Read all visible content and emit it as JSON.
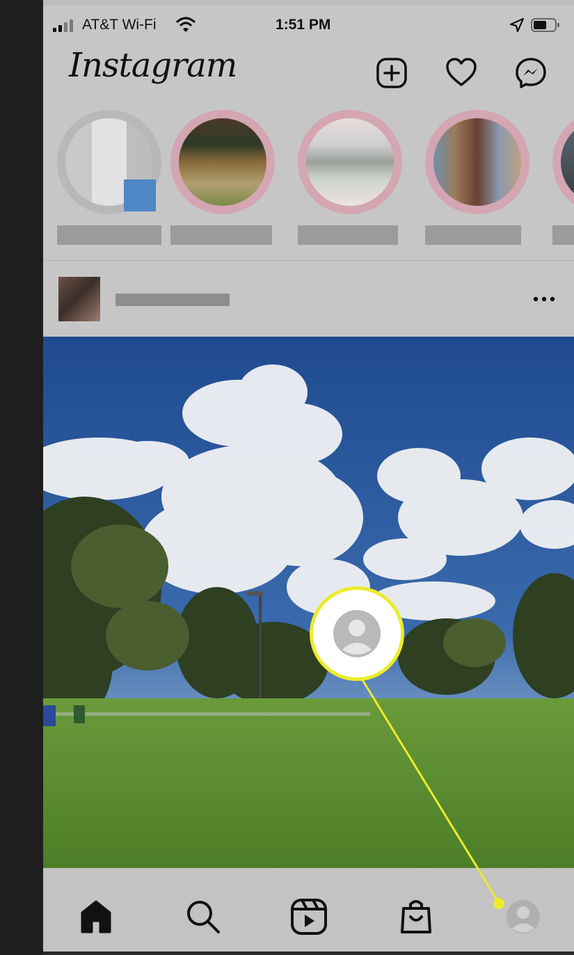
{
  "status_bar": {
    "carrier": "AT&T Wi-Fi",
    "time": "1:51 PM"
  },
  "header": {
    "logo": "Instagram",
    "icons": [
      "new-post-icon",
      "heart-icon",
      "messenger-icon"
    ]
  },
  "stories": {
    "count_visible": 5,
    "names_blurred": true
  },
  "post": {
    "username_blurred": true,
    "more_label": "more-options"
  },
  "bottom_nav": {
    "items": [
      "home-icon",
      "search-icon",
      "reels-icon",
      "shop-icon",
      "profile-icon"
    ]
  },
  "colors": {
    "callout": "#ecec2a",
    "story_ring": "#d4a6b2",
    "sky": "#2f5ea3",
    "grass": "#5c8f32"
  }
}
